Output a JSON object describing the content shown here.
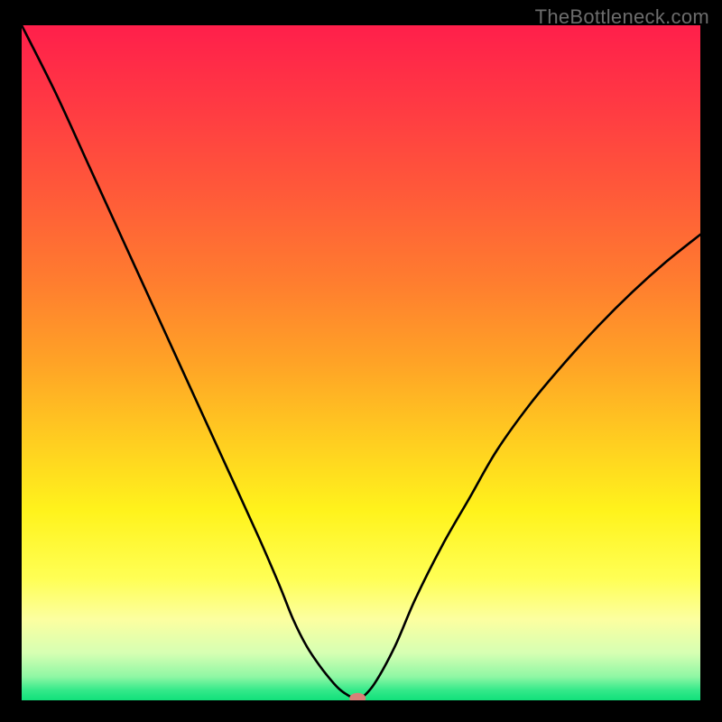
{
  "watermark": "TheBottleneck.com",
  "chart_data": {
    "type": "line",
    "title": "",
    "xlabel": "",
    "ylabel": "",
    "xlim": [
      0,
      100
    ],
    "ylim": [
      0,
      100
    ],
    "x": [
      0,
      5,
      10,
      15,
      20,
      25,
      30,
      35,
      38,
      40,
      42,
      44,
      46,
      47,
      48,
      49,
      50,
      52,
      55,
      58,
      62,
      66,
      70,
      75,
      80,
      85,
      90,
      95,
      100
    ],
    "y": [
      100,
      90,
      79,
      68,
      57,
      46,
      35,
      24,
      17,
      12,
      8,
      5,
      2.5,
      1.5,
      0.8,
      0.3,
      0.3,
      2.5,
      8,
      15,
      23,
      30,
      37,
      44,
      50,
      55.5,
      60.5,
      65,
      69
    ],
    "gradient_stops": [
      {
        "offset": 0.0,
        "color": "#ff1f4b"
      },
      {
        "offset": 0.12,
        "color": "#ff3a43"
      },
      {
        "offset": 0.25,
        "color": "#ff5a39"
      },
      {
        "offset": 0.38,
        "color": "#ff7d2f"
      },
      {
        "offset": 0.5,
        "color": "#ffa326"
      },
      {
        "offset": 0.62,
        "color": "#ffcf20"
      },
      {
        "offset": 0.72,
        "color": "#fff31c"
      },
      {
        "offset": 0.82,
        "color": "#ffff55"
      },
      {
        "offset": 0.88,
        "color": "#fcffa0"
      },
      {
        "offset": 0.93,
        "color": "#d6ffb3"
      },
      {
        "offset": 0.965,
        "color": "#8ff7a4"
      },
      {
        "offset": 0.985,
        "color": "#34e98a"
      },
      {
        "offset": 1.0,
        "color": "#11e07a"
      }
    ],
    "marker": {
      "x": 49.5,
      "y": 0.3,
      "color": "#d88078"
    }
  }
}
